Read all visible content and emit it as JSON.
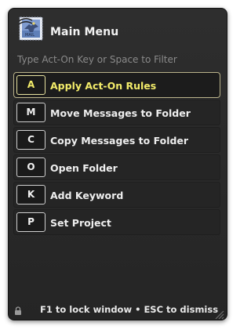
{
  "window": {
    "title": "Main Menu",
    "filter_hint": "Type Act-On Key or Space to Filter",
    "app_icon": "mail-stamp-icon"
  },
  "menu": {
    "items": [
      {
        "key": "A",
        "label": "Apply Act-On Rules",
        "selected": true
      },
      {
        "key": "M",
        "label": "Move Messages to Folder",
        "selected": false
      },
      {
        "key": "C",
        "label": "Copy Messages to Folder",
        "selected": false
      },
      {
        "key": "O",
        "label": "Open Folder",
        "selected": false
      },
      {
        "key": "K",
        "label": "Add Keyword",
        "selected": false
      },
      {
        "key": "P",
        "label": "Set Project",
        "selected": false
      }
    ]
  },
  "footer": {
    "text": "F1 to lock window • ESC to dismiss",
    "lock_icon": "lock-icon",
    "grip_icon": "resize-grip-icon"
  },
  "colors": {
    "panel_bg": "#2a2a2a",
    "highlight": "#f3ec6a",
    "hint_text": "#8a8a8a"
  }
}
